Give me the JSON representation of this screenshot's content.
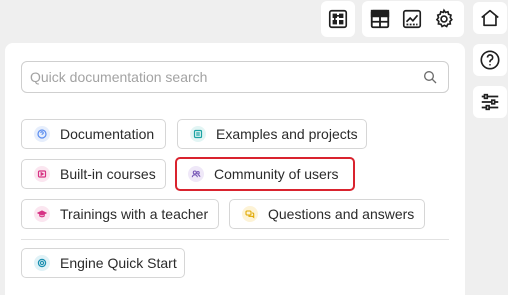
{
  "toolbar": {
    "icons": [
      "scheme-icon",
      "table-layout-icon",
      "chart-icon",
      "gear-icon"
    ]
  },
  "rail": {
    "icons": [
      "home-icon",
      "help-icon",
      "sliders-icon"
    ]
  },
  "search": {
    "placeholder": "Quick documentation search",
    "value": ""
  },
  "links": {
    "documentation": "Documentation",
    "examples": "Examples and projects",
    "courses": "Built-in courses",
    "community": "Community of users",
    "trainings": "Trainings with a teacher",
    "qa": "Questions and answers",
    "quickstart": "Engine Quick Start"
  },
  "colors": {
    "highlight": "#d9232e",
    "doc_icon": "#5b8def",
    "examples_icon": "#1aa3a3",
    "courses_icon": "#d63384",
    "community_icon": "#7a5ab8",
    "trainings_icon": "#d63384",
    "qa_icon": "#e0a800",
    "quickstart_icon": "#1a8fb0"
  }
}
